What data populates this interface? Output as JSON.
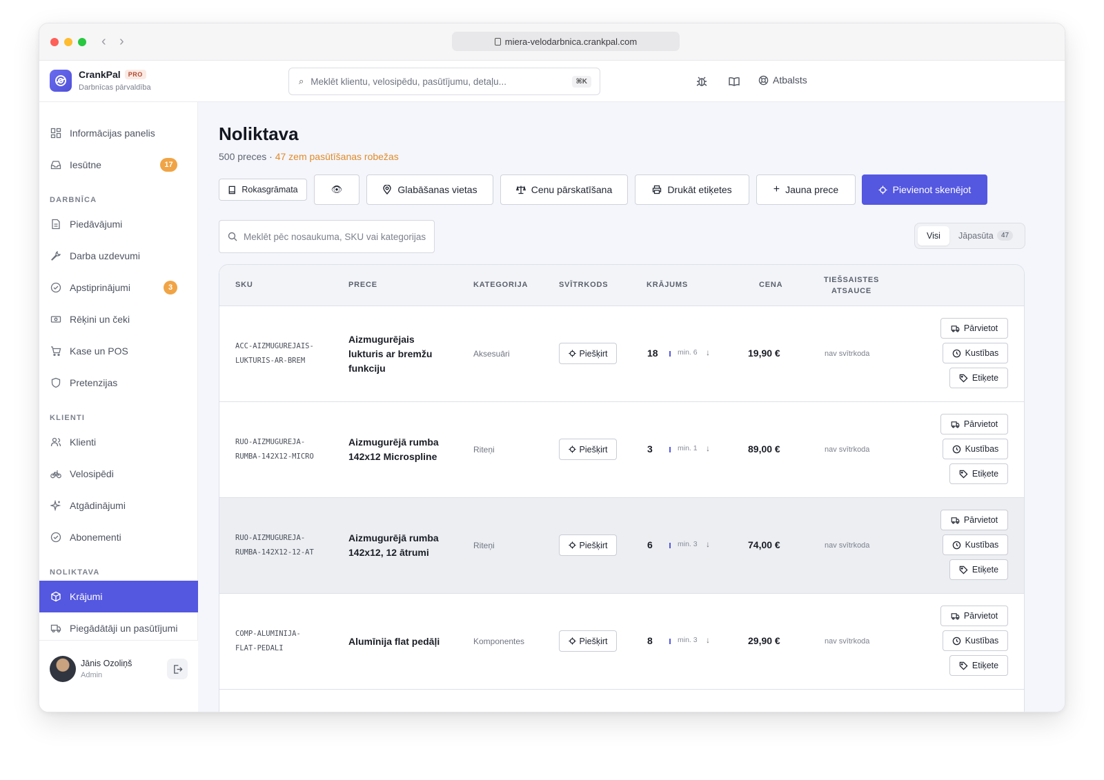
{
  "browser": {
    "url": "miera-velodarbnica.crankpal.com"
  },
  "brand": {
    "name": "CrankPal",
    "badge": "PRO",
    "subtitle": "Darbnīcas pārvaldība"
  },
  "header": {
    "search_placeholder": "Meklēt klientu, velosipēdu, pasūtījumu, detaļu...",
    "shortcut": "⌘K",
    "support_label": "Atbalsts"
  },
  "sidebar": {
    "items_top": [
      {
        "label": "Informācijas panelis",
        "icon": "dashboard-icon"
      },
      {
        "label": "Iesūtne",
        "icon": "inbox-icon",
        "badge": "17"
      }
    ],
    "sections": [
      {
        "title": "DARBNĪCA",
        "items": [
          {
            "label": "Piedāvājumi",
            "icon": "document-icon"
          },
          {
            "label": "Darba uzdevumi",
            "icon": "wrench-icon"
          },
          {
            "label": "Apstiprinājumi",
            "icon": "check-circle-icon",
            "badge": "3"
          },
          {
            "label": "Rēķini un čeki",
            "icon": "cash-icon"
          },
          {
            "label": "Kase un POS",
            "icon": "cart-icon"
          },
          {
            "label": "Pretenzijas",
            "icon": "shield-icon"
          }
        ]
      },
      {
        "title": "KLIENTI",
        "items": [
          {
            "label": "Klienti",
            "icon": "users-icon"
          },
          {
            "label": "Velosipēdi",
            "icon": "bike-icon"
          },
          {
            "label": "Atgādinājumi",
            "icon": "sparkle-icon"
          },
          {
            "label": "Abonementi",
            "icon": "check-circle-icon"
          }
        ]
      },
      {
        "title": "NOLIKTAVA",
        "items": [
          {
            "label": "Krājumi",
            "icon": "box-icon",
            "active": true
          },
          {
            "label": "Piegādātāji un pasūtījumi",
            "icon": "truck-icon"
          }
        ]
      }
    ],
    "user": {
      "name": "Jānis Ozoliņš",
      "role": "Admin"
    }
  },
  "page": {
    "title": "Noliktava",
    "count_text": "500 preces · ",
    "warning_text": "47 zem pasūtīšanas robežas"
  },
  "toolbar": {
    "handbook": "Rokasgrāmata",
    "eye": "👁",
    "locations": "Glabāšanas vietas",
    "price_review": "Cenu pārskatīšana",
    "print_labels": "Drukāt etiķetes",
    "new_item": "Jauna prece",
    "add_scanner": "Pievienot skenējot"
  },
  "filter": {
    "search_placeholder": "Meklēt pēc nosaukuma, SKU vai kategorijas",
    "tab_all": "Visi",
    "tab_reorder": "Jāpasūta",
    "tab_reorder_count": "47"
  },
  "table": {
    "columns": {
      "sku": "SKU",
      "item": "PRECE",
      "category": "KATEGORIJA",
      "barcode": "SVĪTRKODS",
      "stock": "KRĀJUMS",
      "price": "CENA",
      "online_line1": "TIEŠSAISTES",
      "online_line2": "ATSAUCE"
    },
    "assign_label": "Piešķirt",
    "action_move": "Pārvietot",
    "action_movements": "Kustības",
    "action_label": "Etiķete",
    "rows": [
      {
        "sku1": "ACC-AIZMUGUREJAIS-",
        "sku2": "LUKTURIS-AR-BREM",
        "name1": "Aizmugurējais",
        "name2": "lukturis ar bremžu",
        "name3": "funkciju",
        "category": "Aksesuāri",
        "stock": "18",
        "min": "min. 6",
        "price": "19,90 €",
        "online": "nav svītrkoda"
      },
      {
        "sku1": "RUO-AIZMUGUREJA-",
        "sku2": "RUMBA-142X12-MICRO",
        "name1": "Aizmugurējā rumba",
        "name2": "142x12 Microspline",
        "name3": "",
        "category": "Riteņi",
        "stock": "3",
        "min": "min. 1",
        "price": "89,00 €",
        "online": "nav svītrkoda"
      },
      {
        "sku1": "RUO-AIZMUGUREJA-",
        "sku2": "RUMBA-142X12-12-AT",
        "name1": "Aizmugurējā rumba",
        "name2": "142x12, 12 ātrumi",
        "name3": "",
        "category": "Riteņi",
        "stock": "6",
        "min": "min. 3",
        "price": "74,00 €",
        "online": "nav svītrkoda"
      },
      {
        "sku1": "COMP-ALUMINIJA-",
        "sku2": "FLAT-PEDALI",
        "name1": "Alumīnija flat pedāļi",
        "name2": "",
        "name3": "",
        "category": "Komponentes",
        "stock": "8",
        "min": "min. 3",
        "price": "29,90 €",
        "online": "nav svītrkoda"
      }
    ]
  },
  "colors": {
    "accent": "#5457e0",
    "badge": "#f0a446",
    "warning": "#e28a27"
  }
}
